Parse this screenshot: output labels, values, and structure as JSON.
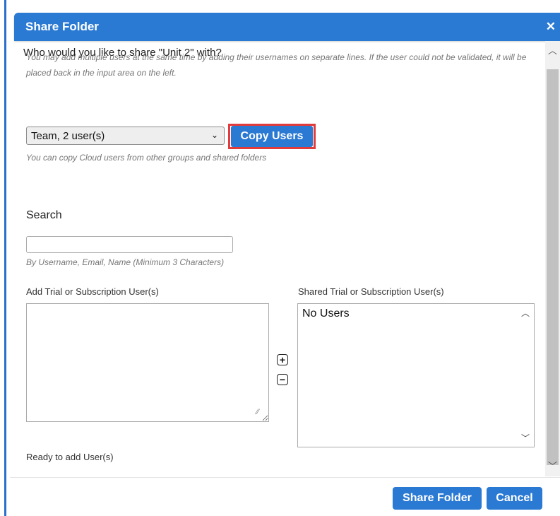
{
  "dialog": {
    "title": "Share Folder",
    "close_icon": "close-icon"
  },
  "content": {
    "question": "Who would you like to share \"Unit 2\" with?",
    "intro_hint": "You may add multiple users at the same time by adding their usernames on separate lines. If the user could not be validated, it will be placed back in the input area on the left.",
    "group_select": {
      "value": "Team, 2 user(s)"
    },
    "copy_button_label": "Copy Users",
    "copy_hint": "You can copy Cloud users from other groups and shared folders",
    "search_label": "Search",
    "search_value": "",
    "search_hint": "By Username, Email, Name (Minimum 3 Characters)",
    "add_users_label": "Add Trial or Subscription User(s)",
    "shared_users_label": "Shared Trial or Subscription User(s)",
    "shared_users": [
      "No Users"
    ],
    "status": "Ready to add User(s)"
  },
  "footer": {
    "share_label": "Share Folder",
    "cancel_label": "Cancel"
  },
  "colors": {
    "accent": "#2a79d3",
    "highlight": "#e23b3b"
  }
}
